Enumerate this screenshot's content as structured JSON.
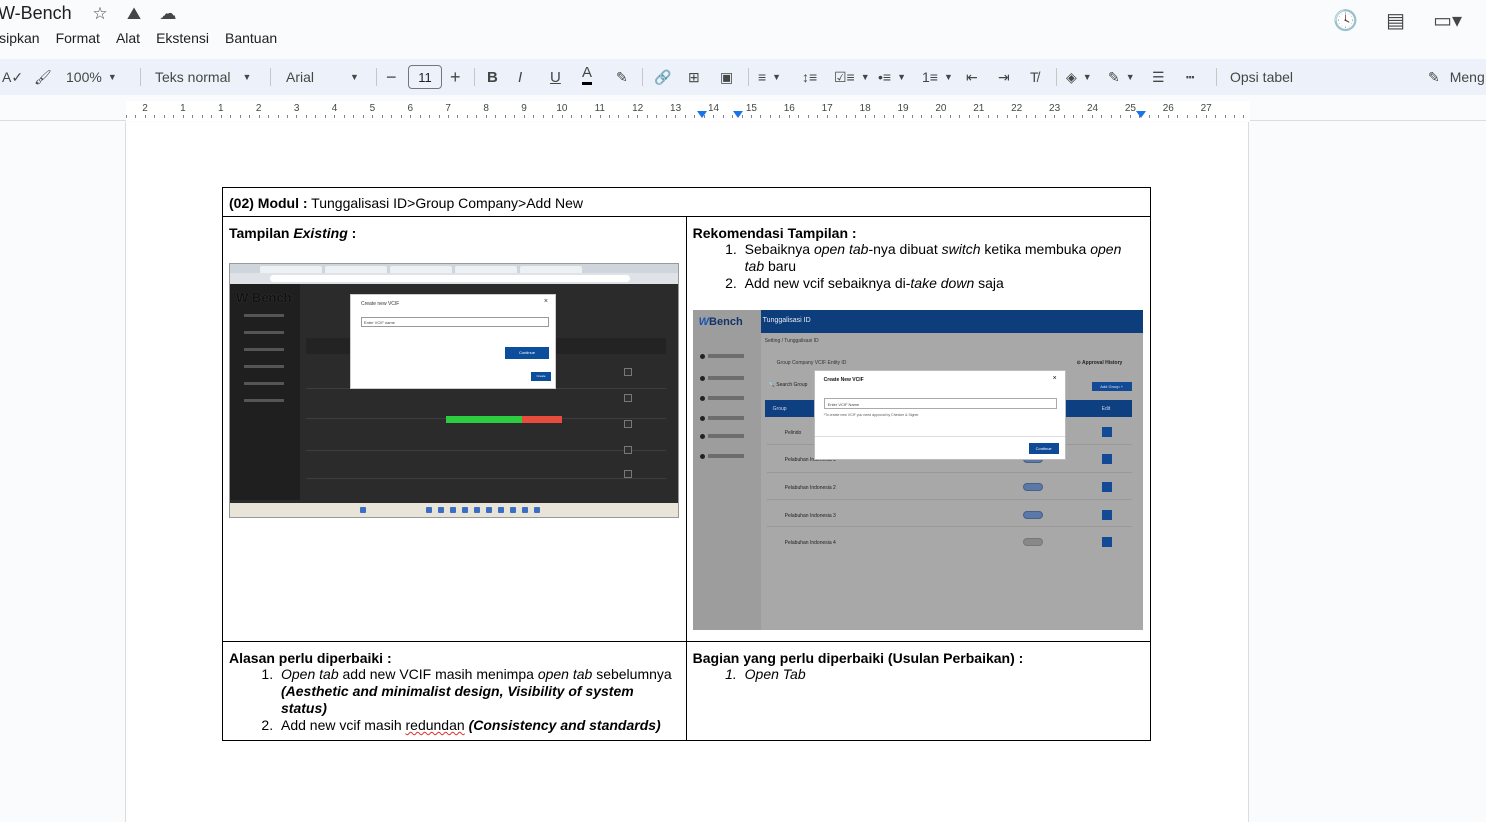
{
  "app": {
    "doc_title": "W-Bench",
    "menu": [
      "isipkan",
      "Format",
      "Alat",
      "Ekstensi",
      "Bantuan"
    ]
  },
  "toolbar": {
    "zoom": "100%",
    "style": "Teks normal",
    "font": "Arial",
    "font_size": "11",
    "table_options": "Opsi tabel",
    "editing": "Meng"
  },
  "ruler": {
    "numbers": [
      "2",
      "1",
      "1",
      "2",
      "3",
      "4",
      "5",
      "6",
      "7",
      "8",
      "9",
      "10",
      "11",
      "12",
      "13",
      "14",
      "15",
      "16",
      "17",
      "18",
      "19",
      "20",
      "21",
      "22",
      "23",
      "24",
      "25",
      "26",
      "27"
    ]
  },
  "table": {
    "module_label": "(02) Modul :",
    "module_path": " Tunggalisasi ID>Group Company>Add New",
    "existing": {
      "label": "Tampilan ",
      "label_italic": "Existing",
      "label_end": " :"
    },
    "recommend": {
      "heading": "Rekomendasi Tampilan :",
      "item1": {
        "a": "Sebaiknya ",
        "b": "open tab",
        "c": "-nya dibuat ",
        "d": "switch",
        "e": " ketika membuka ",
        "f": "open tab",
        "g": " baru"
      },
      "item2": {
        "a": "Add new vcif sebaiknya di-",
        "b": "take down",
        "c": " saja"
      }
    },
    "reason": {
      "heading": "Alasan perlu diperbaiki :",
      "item1": {
        "a": "Open tab",
        "b": " add new VCIF masih menimpa ",
        "c": "open tab",
        "d": " sebelumnya ",
        "e": "(Aesthetic and minimalist design, Visibility of system status)"
      },
      "item2": {
        "a": "Add new vcif masih ",
        "b": "redundan",
        "c": " ",
        "d": "(Consistency and standards)"
      }
    },
    "fix": {
      "heading": "Bagian yang perlu diperbaiki (Usulan Perbaikan) :",
      "item1": "Open Tab"
    }
  },
  "shot1": {
    "logo": "W Bench",
    "modal_title": "Create new VCIF",
    "input_placeholder": "Enter VCIF name",
    "continue": "Continue",
    "create": "Create"
  },
  "shot2": {
    "logo_w": "W",
    "logo_text": "Bench",
    "topbar_title": "Tunggalisasi ID",
    "breadcrumb": "Setting / Tunggalisasi ID",
    "tabs": "Group Company      VCIF      Entity ID",
    "approval": "⊙ Approval History",
    "search": "🔍  Search Group",
    "add_button": "Add Group  +",
    "col_group": "Group",
    "col_edit": "Edit",
    "modal_title": "Create New VCIF",
    "input_placeholder": "Enter VCIF Name",
    "hint": "*To create new VCIF you need approval by Checker & Signer",
    "continue": "Continue",
    "rows": [
      "Pelindo",
      "Pelabuhan Indonesia 1",
      "Pelabuhan Indonesia 2",
      "Pelabuhan Indonesia 3",
      "Pelabuhan Indonesia 4"
    ]
  }
}
